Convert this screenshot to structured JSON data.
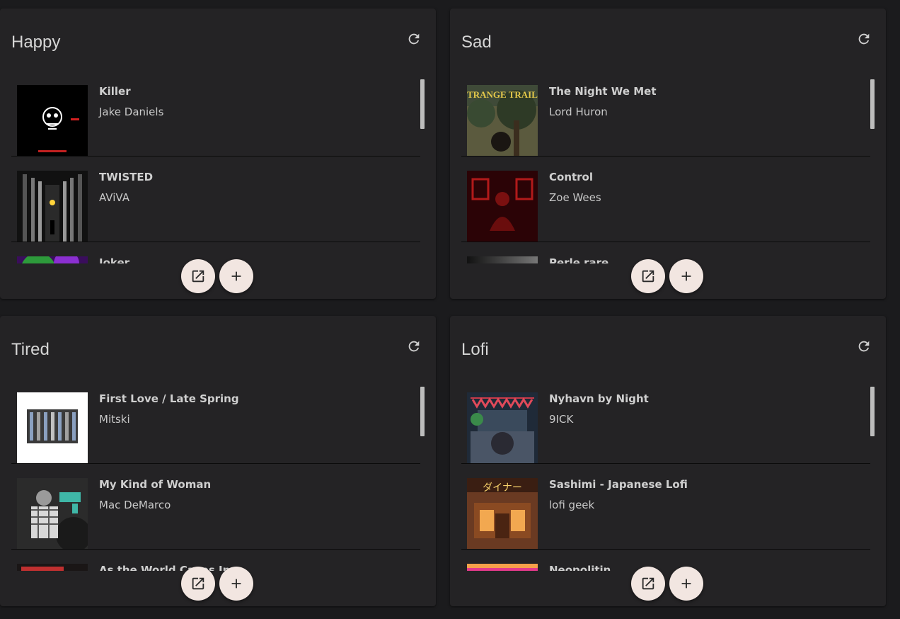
{
  "cards": [
    {
      "title": "Happy",
      "songs": [
        {
          "title": "Killer",
          "artist": "Jake Daniels"
        },
        {
          "title": "TWISTED",
          "artist": "AViVA"
        },
        {
          "title": "Joker",
          "artist": ""
        }
      ]
    },
    {
      "title": "Sad",
      "songs": [
        {
          "title": "The Night We Met",
          "artist": "Lord Huron"
        },
        {
          "title": "Control",
          "artist": "Zoe Wees"
        },
        {
          "title": "Perle rare",
          "artist": ""
        }
      ]
    },
    {
      "title": "Tired",
      "songs": [
        {
          "title": "First Love / Late Spring",
          "artist": "Mitski"
        },
        {
          "title": "My Kind of Woman",
          "artist": "Mac DeMarco"
        },
        {
          "title": "As the World Caves In",
          "artist": ""
        }
      ]
    },
    {
      "title": "Lofi",
      "songs": [
        {
          "title": "Nyhavn by Night",
          "artist": "9ICK"
        },
        {
          "title": "Sashimi - Japanese Lofi",
          "artist": "lofi geek"
        },
        {
          "title": "Neopolitin",
          "artist": ""
        }
      ]
    }
  ],
  "art_text": {
    "strange_trails": "STRANGE TRAILS",
    "diner": "ダイナー"
  },
  "icons": {
    "refresh": "refresh-icon",
    "open": "open-in-new-icon",
    "add": "add-icon"
  },
  "colors": {
    "background": "#1b1b1d",
    "card": "#242325",
    "fab": "#f2e6e1",
    "scrollbar": "#bdbdbd"
  }
}
